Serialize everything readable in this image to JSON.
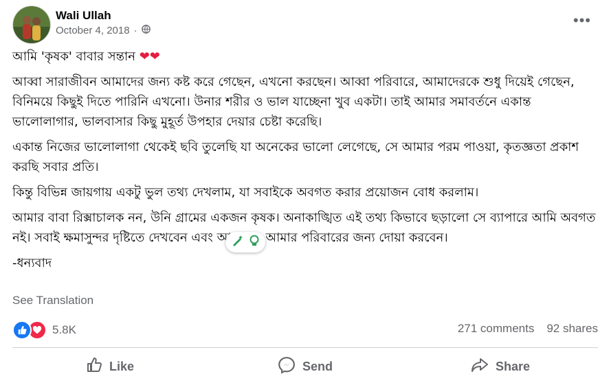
{
  "author": {
    "name": "Wali Ullah",
    "date": "October 4, 2018",
    "privacy_icon": "globe-icon"
  },
  "post": {
    "title": "আমি  'কৃষক' বাবার সন্তান",
    "hearts": "❤❤",
    "paragraphs": [
      "আব্বা সারাজীবন আমাদের জন্য কষ্ট করে গেছেন, এখনো করছেন। আব্বা পরিবারে, আমাদেরকে শুধু দিয়েই গেছেন, বিনিময়ে কিছুই দিতে পারিনি এখনো। উনার শরীর ও ভাল যাচ্ছেনা খুব একটা। তাই আমার সমাবর্তনে একান্ত ভালোলাগার, ভালবাসার কিছু মুহূর্ত উপহার দেয়ার চেষ্টা করেছি।",
      "একান্ত নিজের ভালোলাগা থেকেই ছবি তুলেছি যা অনেকের ভালো লেগেছে, সে আমার পরম পাওয়া, কৃতজ্ঞতা প্রকাশ করছি সবার প্রতি।",
      "কিন্তু বিভিন্ন জায়গায় একটু ভুল তথ্য দেখলাম, যা সবাইকে অবগত করার প্রয়োজন বোধ করলাম।",
      "আমার বাবা রিক্সাচালক নন, উনি গ্রামের একজন কৃষক। অনাকাঙ্খিত এই তথ্য কিভাবে ছড়ালো সে ব্যাপারে আমি অবগত নই। সবাই ক্ষমাসুন্দর দৃষ্টিতে দেখবেন এবং আমার ও আমার পরিবারের জন্য দোয়া করবেন।",
      "-ধন্যবাদ"
    ]
  },
  "see_translation": "See Translation",
  "stats": {
    "reaction_count": "5.8K",
    "comments": "271 comments",
    "shares": "92 shares"
  },
  "actions": {
    "like": "Like",
    "send": "Send",
    "share": "Share"
  },
  "colors": {
    "like_blue": "#1877f2",
    "love_red": "#f02849",
    "secondary_text": "#65676b"
  }
}
